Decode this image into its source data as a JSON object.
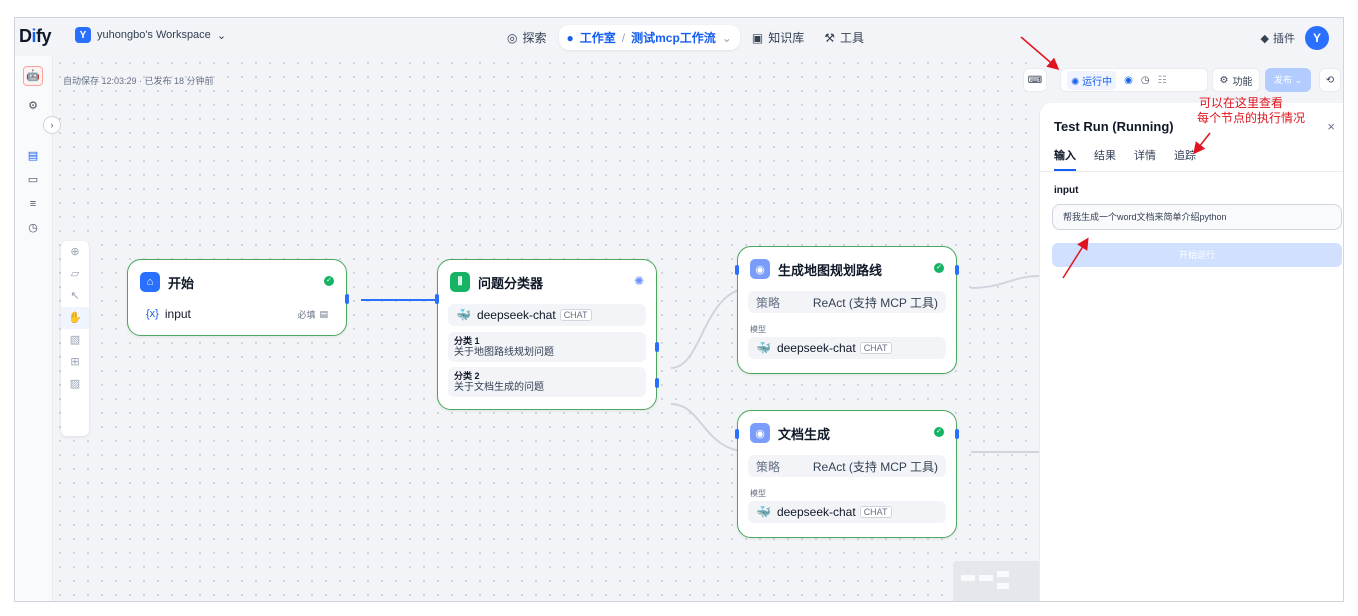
{
  "logo": {
    "prefix": "D",
    "i": "i",
    "suffix": "fy"
  },
  "workspace": {
    "avatar": "Y",
    "name": "yuhongbo's Workspace"
  },
  "nav": {
    "explore": "探索",
    "studio": "工作室",
    "app_name": "测试mcp工作流",
    "knowledge": "知识库",
    "tools": "工具"
  },
  "top_right": {
    "plugins": "插件",
    "avatar": "Y"
  },
  "autosave": "自动保存 12:03:29 · 已发布 18 分钟前",
  "toolbar": {
    "running": "运行中",
    "features": "功能",
    "publish": "发布"
  },
  "nodes": {
    "start": {
      "title": "开始",
      "var": "input",
      "var_prefix": "{x}",
      "required": "必填"
    },
    "classifier": {
      "title": "问题分类器",
      "model": "deepseek-chat",
      "model_tag": "CHAT",
      "classes": [
        {
          "name": "分类 1",
          "desc": "关于地图路线规划问题"
        },
        {
          "name": "分类 2",
          "desc": "关于文档生成的问题"
        }
      ]
    },
    "map_agent": {
      "title": "生成地图规划路线",
      "strategy_label": "策略",
      "strategy": "ReAct (支持 MCP 工具)",
      "model_label": "模型",
      "model": "deepseek-chat",
      "model_tag": "CHAT"
    },
    "doc_agent": {
      "title": "文档生成",
      "strategy_label": "策略",
      "strategy": "ReAct (支持 MCP 工具)",
      "model_label": "模型",
      "model": "deepseek-chat",
      "model_tag": "CHAT"
    }
  },
  "panel": {
    "title": "Test Run (Running)",
    "tabs": [
      "输入",
      "结果",
      "详情",
      "追踪"
    ],
    "field_label": "input",
    "field_value": "帮我生成一个word文档来简单介绍python",
    "run_button": "开始运行"
  },
  "annotation": {
    "line1": "可以在这里查看",
    "line2": "每个节点的执行情况"
  },
  "colors": {
    "accent": "#155eef",
    "success": "#16b364",
    "annotation": "#e0141e",
    "node_border": "#4ca75f"
  }
}
